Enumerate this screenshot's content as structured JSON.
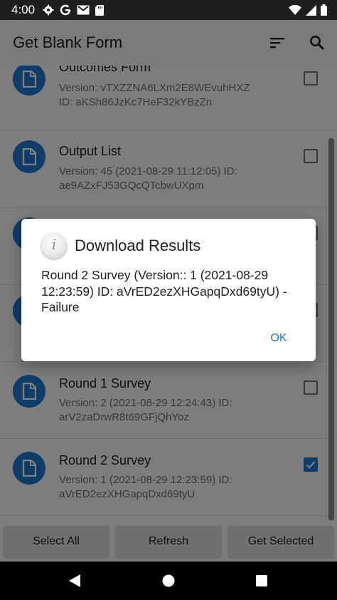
{
  "status_bar": {
    "time": "4:00",
    "left_icons": [
      "gear-icon",
      "google-icon",
      "gmail-icon",
      "sd-card-icon"
    ],
    "right_icons": [
      "wifi-icon",
      "signal-icon",
      "battery-icon"
    ]
  },
  "toolbar": {
    "title": "Get Blank Form",
    "icons": [
      "sort-icon",
      "search-icon"
    ]
  },
  "forms": [
    {
      "name": "Outcomes Form",
      "version": "Version: vTXZZNA6LXm2E8WEvuhHXZ",
      "id": "ID: aKSh86JzKc7HeF32kYBzZn",
      "checked": false
    },
    {
      "name": "Output List",
      "version": "Version: 45 (2021-08-29 11:12:05) ID:",
      "id": "ae9AZxFJ53GQcQTcbwUXpm",
      "checked": false
    },
    {
      "name": "",
      "version": "",
      "id": "",
      "checked": false
    },
    {
      "name": "",
      "version": "",
      "id": "",
      "checked": false
    },
    {
      "name": "Round 1 Survey",
      "version": "Version: 2 (2021-08-29 12:24:43) ID:",
      "id": "arV2zaDrwR8t69GFjQhYoz",
      "checked": false
    },
    {
      "name": "Round 2 Survey",
      "version": "Version: 1 (2021-08-29 12:23:59) ID:",
      "id": "aVrED2ezXHGapqDxd69tyU",
      "checked": true
    }
  ],
  "actions": {
    "select_all": "Select All",
    "refresh": "Refresh",
    "get_selected": "Get Selected"
  },
  "dialog": {
    "title": "Download Results",
    "message": "Round 2 Survey (Version:: 1 (2021-08-29 12:23:59) ID: aVrED2ezXHGapqDxd69tyU) - Failure",
    "ok": "OK"
  },
  "colors": {
    "accent": "#1e7ad1",
    "status_bar": "#1f1f1f",
    "scrim": "rgba(0,0,0,0.5)"
  }
}
